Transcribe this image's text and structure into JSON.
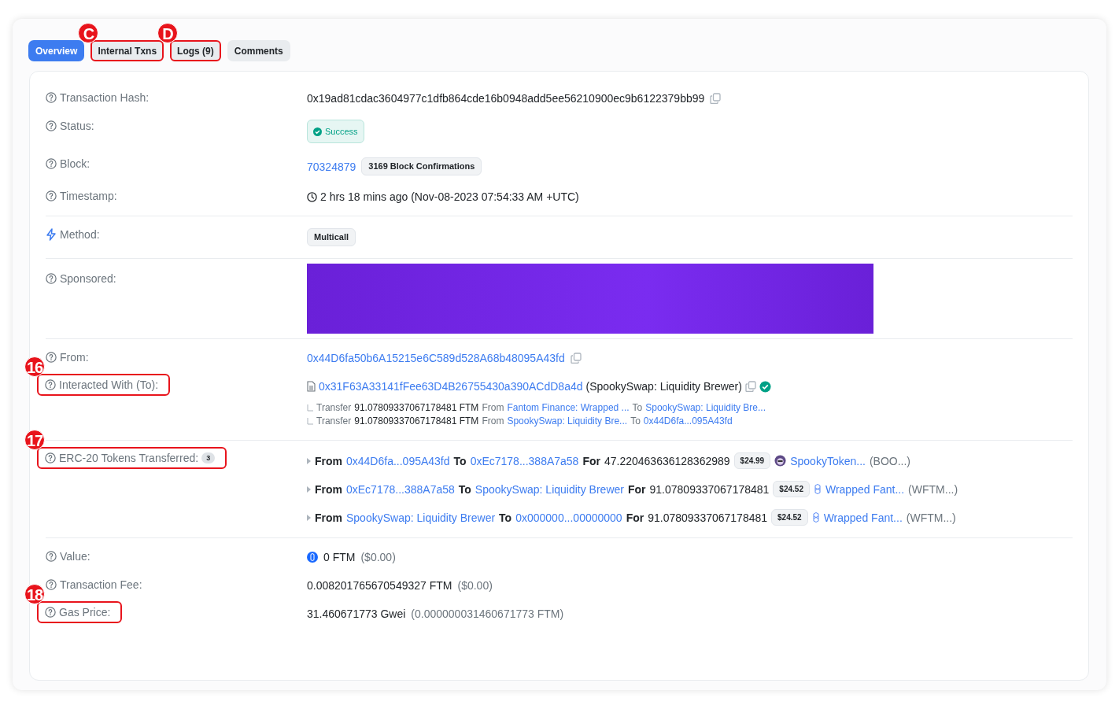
{
  "tabs": [
    {
      "label": "Overview",
      "selected": true
    },
    {
      "label": "Internal Txns",
      "selected": false,
      "callout": "C"
    },
    {
      "label": "Logs (9)",
      "selected": false,
      "callout": "D"
    },
    {
      "label": "Comments",
      "selected": false
    }
  ],
  "sections": [
    [
      {
        "label": "Transaction Hash:",
        "kind": "hash",
        "parts": [
          {
            "text": "0x19ad81cdac3604977c1dfb864cde16b0948add5ee56210900ec9b6122379bb99",
            "kind": "plain"
          }
        ]
      },
      {
        "label": "Status:",
        "kind": "status",
        "parts": [
          {
            "text": "Success",
            "kind": "success"
          }
        ]
      },
      {
        "label": "Block:",
        "kind": "plain",
        "parts": [
          {
            "text": "70324879",
            "kind": "link"
          },
          {
            "text": "3169 Block Confirmations",
            "kind": "chip"
          }
        ]
      },
      {
        "label": "Timestamp:",
        "kind": "timestamp",
        "parts": [
          {
            "text": "2 hrs 18 mins ago (Nov-08-2023 07:54:33 AM +UTC)",
            "kind": "plain"
          }
        ]
      }
    ],
    [
      {
        "label": "Method:",
        "kind": "method",
        "parts": [
          {
            "text": "Multicall",
            "kind": "chip"
          }
        ]
      }
    ],
    [
      {
        "label": "Sponsored:",
        "kind": "banner"
      }
    ],
    [
      {
        "label": "From:",
        "kind": "address",
        "parts": [
          {
            "text": "0x44D6fa50b6A15215e6C589d528A68b48095A43fd",
            "kind": "link"
          }
        ]
      },
      {
        "label": "Interacted With (To):",
        "kind": "contract",
        "callout": "16",
        "parts": [
          {
            "text": "0x31F63A33141fFee63D4B26755430a390ACdD8a4d",
            "kind": "link"
          },
          {
            "text": "(SpookySwap: Liquidity Brewer)",
            "kind": "plain"
          }
        ],
        "transfers": [
          [
            {
              "text": "Transfer",
              "kind": "muted"
            },
            {
              "text": "91.07809337067178481 FTM",
              "kind": "plain"
            },
            {
              "text": "From",
              "kind": "muted"
            },
            {
              "text": "Fantom Finance: Wrapped ...",
              "kind": "link"
            },
            {
              "text": "To",
              "kind": "muted"
            },
            {
              "text": "SpookySwap: Liquidity Bre...",
              "kind": "link"
            }
          ],
          [
            {
              "text": "Transfer",
              "kind": "muted"
            },
            {
              "text": "91.07809337067178481 FTM",
              "kind": "plain"
            },
            {
              "text": "From",
              "kind": "muted"
            },
            {
              "text": "SpookySwap: Liquidity Bre...",
              "kind": "link"
            },
            {
              "text": "To",
              "kind": "muted"
            },
            {
              "text": "0x44D6fa...095A43fd",
              "kind": "link"
            }
          ]
        ]
      }
    ],
    [
      {
        "label": "ERC-20 Tokens Transferred:",
        "kind": "tokens",
        "count": "3",
        "callout": "17",
        "transfers": [
          {
            "kind": "avatar",
            "parts": [
              {
                "text": "From",
                "kind": "bold"
              },
              {
                "text": "0x44D6fa...095A43fd",
                "kind": "link"
              },
              {
                "text": "To",
                "kind": "bold"
              },
              {
                "text": "0xEc7178...388A7a58",
                "kind": "link"
              },
              {
                "text": "For",
                "kind": "bold"
              },
              {
                "text": "47.220463636128362989",
                "kind": "plain"
              },
              {
                "text": "$24.99",
                "kind": "chip"
              },
              {
                "text": "SpookyToken...",
                "kind": "token"
              },
              {
                "text": "(BOO...)",
                "kind": "muted"
              }
            ]
          },
          {
            "kind": "coin",
            "parts": [
              {
                "text": "From",
                "kind": "bold"
              },
              {
                "text": "0xEc7178...388A7a58",
                "kind": "link"
              },
              {
                "text": "To",
                "kind": "bold"
              },
              {
                "text": "SpookySwap: Liquidity Brewer",
                "kind": "link"
              },
              {
                "text": "For",
                "kind": "bold"
              },
              {
                "text": "91.07809337067178481",
                "kind": "plain"
              },
              {
                "text": "$24.52",
                "kind": "chip"
              },
              {
                "text": "Wrapped Fant...",
                "kind": "token"
              },
              {
                "text": "(WFTM...)",
                "kind": "muted"
              }
            ]
          },
          {
            "kind": "coin",
            "parts": [
              {
                "text": "From",
                "kind": "bold"
              },
              {
                "text": "SpookySwap: Liquidity Brewer",
                "kind": "link"
              },
              {
                "text": "To",
                "kind": "bold"
              },
              {
                "text": "0x000000...00000000",
                "kind": "link"
              },
              {
                "text": "For",
                "kind": "bold"
              },
              {
                "text": "91.07809337067178481",
                "kind": "plain"
              },
              {
                "text": "$24.52",
                "kind": "chip"
              },
              {
                "text": "Wrapped Fant...",
                "kind": "token"
              },
              {
                "text": "(WFTM...)",
                "kind": "muted"
              }
            ]
          }
        ]
      }
    ],
    [
      {
        "label": "Value:",
        "kind": "value",
        "parts": [
          {
            "text": "0 FTM",
            "kind": "plain"
          },
          {
            "text": "($0.00)",
            "kind": "muted"
          }
        ]
      },
      {
        "label": "Transaction Fee:",
        "kind": "plain",
        "parts": [
          {
            "text": "0.008201765670549327 FTM",
            "kind": "plain"
          },
          {
            "text": "($0.00)",
            "kind": "muted"
          }
        ]
      },
      {
        "label": "Gas Price:",
        "kind": "plain",
        "callout": "18",
        "parts": [
          {
            "text": "31.460671773 Gwei",
            "kind": "plain"
          },
          {
            "text": "(0.000000031460671773 FTM)",
            "kind": "muted"
          }
        ]
      }
    ]
  ]
}
